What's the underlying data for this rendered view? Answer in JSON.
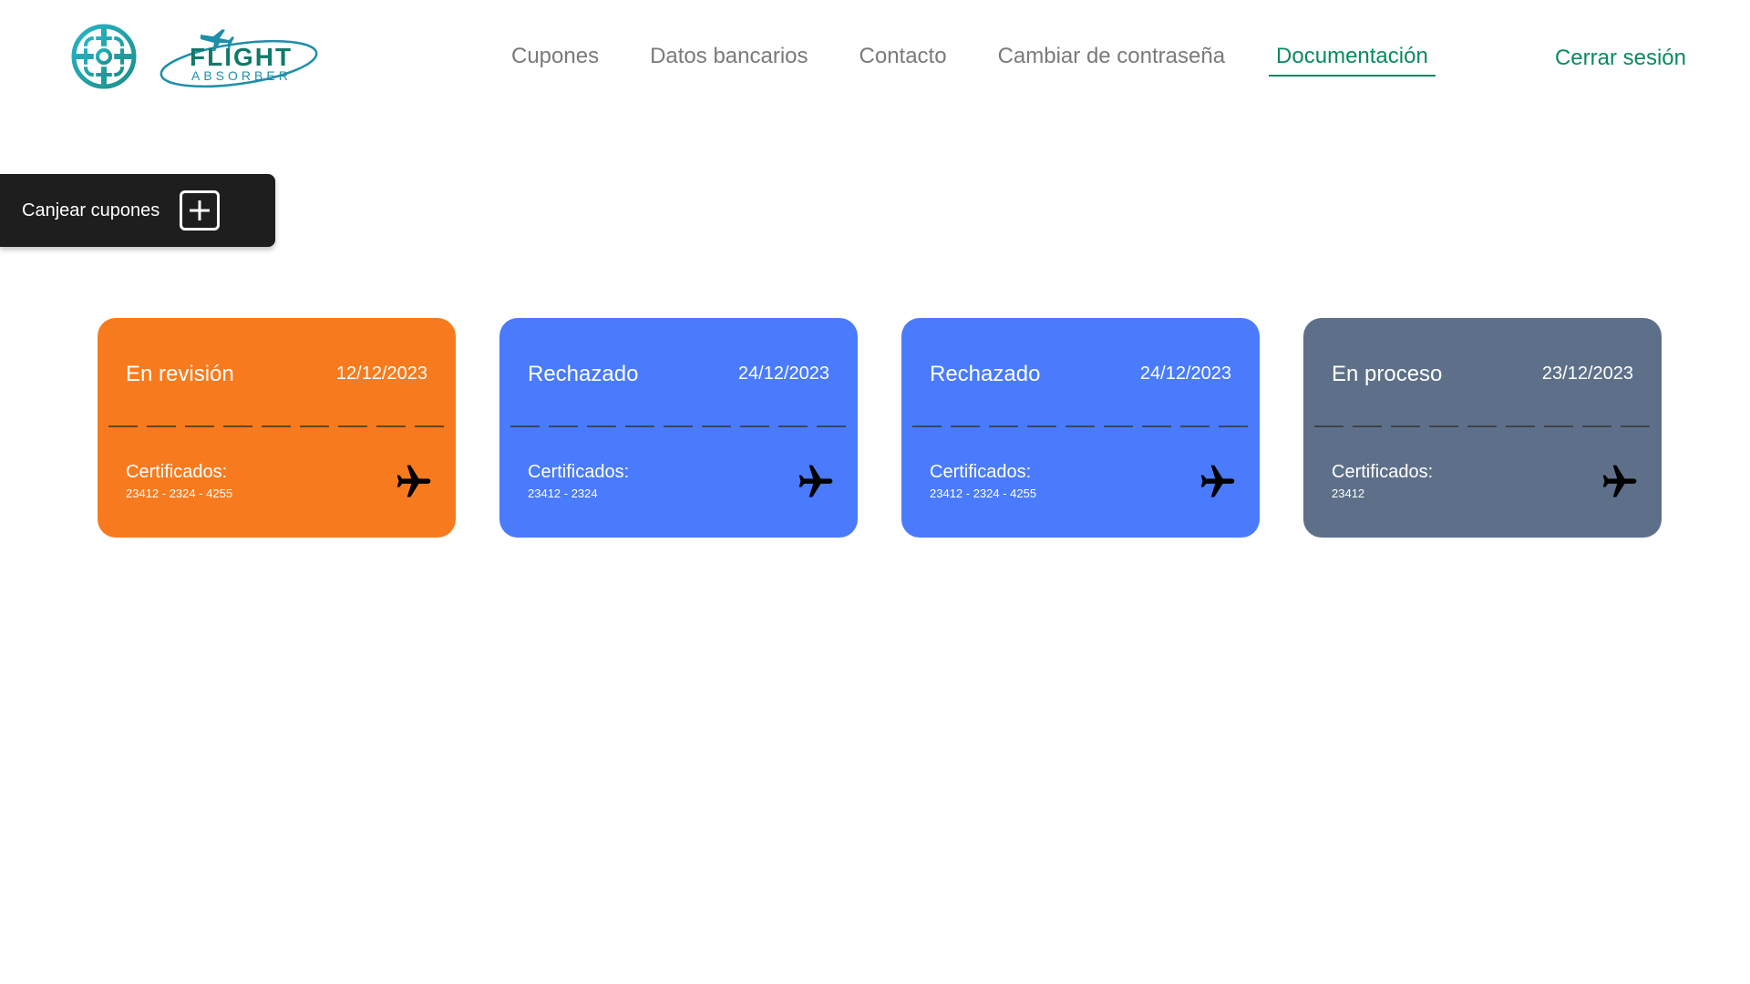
{
  "header": {
    "logo_alt": "FLIGHT ABSORBER",
    "nav": [
      {
        "label": "Cupones",
        "active": false
      },
      {
        "label": "Datos bancarios",
        "active": false
      },
      {
        "label": "Contacto",
        "active": false
      },
      {
        "label": "Cambiar de contraseña",
        "active": false
      },
      {
        "label": "Documentación",
        "active": true
      }
    ],
    "logout_label": "Cerrar sesión"
  },
  "redeem": {
    "label": "Canjear cupones",
    "icon": "plus-square-icon"
  },
  "cards": [
    {
      "status": "En revisión",
      "date": "12/12/2023",
      "cert_label": "Certificados:",
      "cert_values": "23412 - 2324 - 4255",
      "color": "#F77B1E",
      "icon": "airplane-icon"
    },
    {
      "status": "Rechazado",
      "date": "24/12/2023",
      "cert_label": "Certificados:",
      "cert_values": "23412 - 2324",
      "color": "#4A7BFD",
      "icon": "airplane-icon"
    },
    {
      "status": "Rechazado",
      "date": "24/12/2023",
      "cert_label": "Certificados:",
      "cert_values": "23412 - 2324 - 4255",
      "color": "#4A7BFD",
      "icon": "airplane-icon"
    },
    {
      "status": "En proceso",
      "date": "23/12/2023",
      "cert_label": "Certificados:",
      "cert_values": "23412",
      "color": "#5E7089",
      "icon": "airplane-icon"
    }
  ],
  "colors": {
    "accent": "#0A8A60",
    "nav_text": "#7A7A7A",
    "redeem_bg": "#1E1E1E"
  }
}
